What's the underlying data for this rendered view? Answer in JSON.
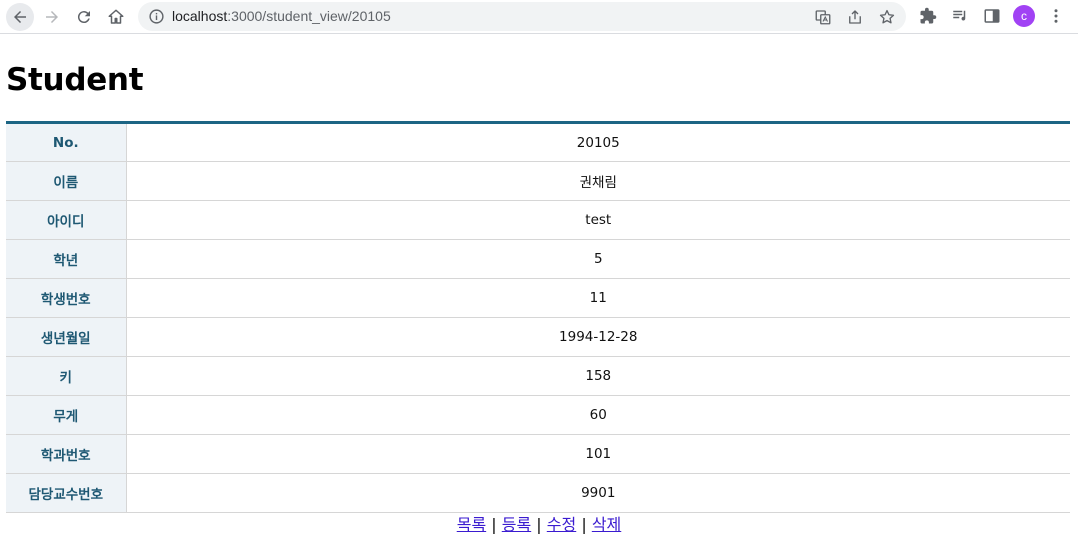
{
  "browser": {
    "url_host": "localhost",
    "url_path": ":3000/student_view/20105",
    "profile_initial": "c",
    "profile_color": "#a142f4"
  },
  "page": {
    "title": "Student"
  },
  "student": {
    "rows": [
      {
        "label": "No.",
        "value": "20105"
      },
      {
        "label": "이름",
        "value": "권채림"
      },
      {
        "label": "아이디",
        "value": "test"
      },
      {
        "label": "학년",
        "value": "5"
      },
      {
        "label": "학생번호",
        "value": "11"
      },
      {
        "label": "생년월일",
        "value": "1994-12-28"
      },
      {
        "label": "키",
        "value": "158"
      },
      {
        "label": "무게",
        "value": "60"
      },
      {
        "label": "학과번호",
        "value": "101"
      },
      {
        "label": "담당교수번호",
        "value": "9901"
      }
    ]
  },
  "actions": {
    "list": "목록",
    "register": "등록",
    "edit": "수정",
    "delete": "삭제",
    "separator": "|"
  },
  "colors": {
    "header_border": "#1c6584",
    "label_bg": "#eef3f7",
    "label_text": "#1e5873"
  }
}
